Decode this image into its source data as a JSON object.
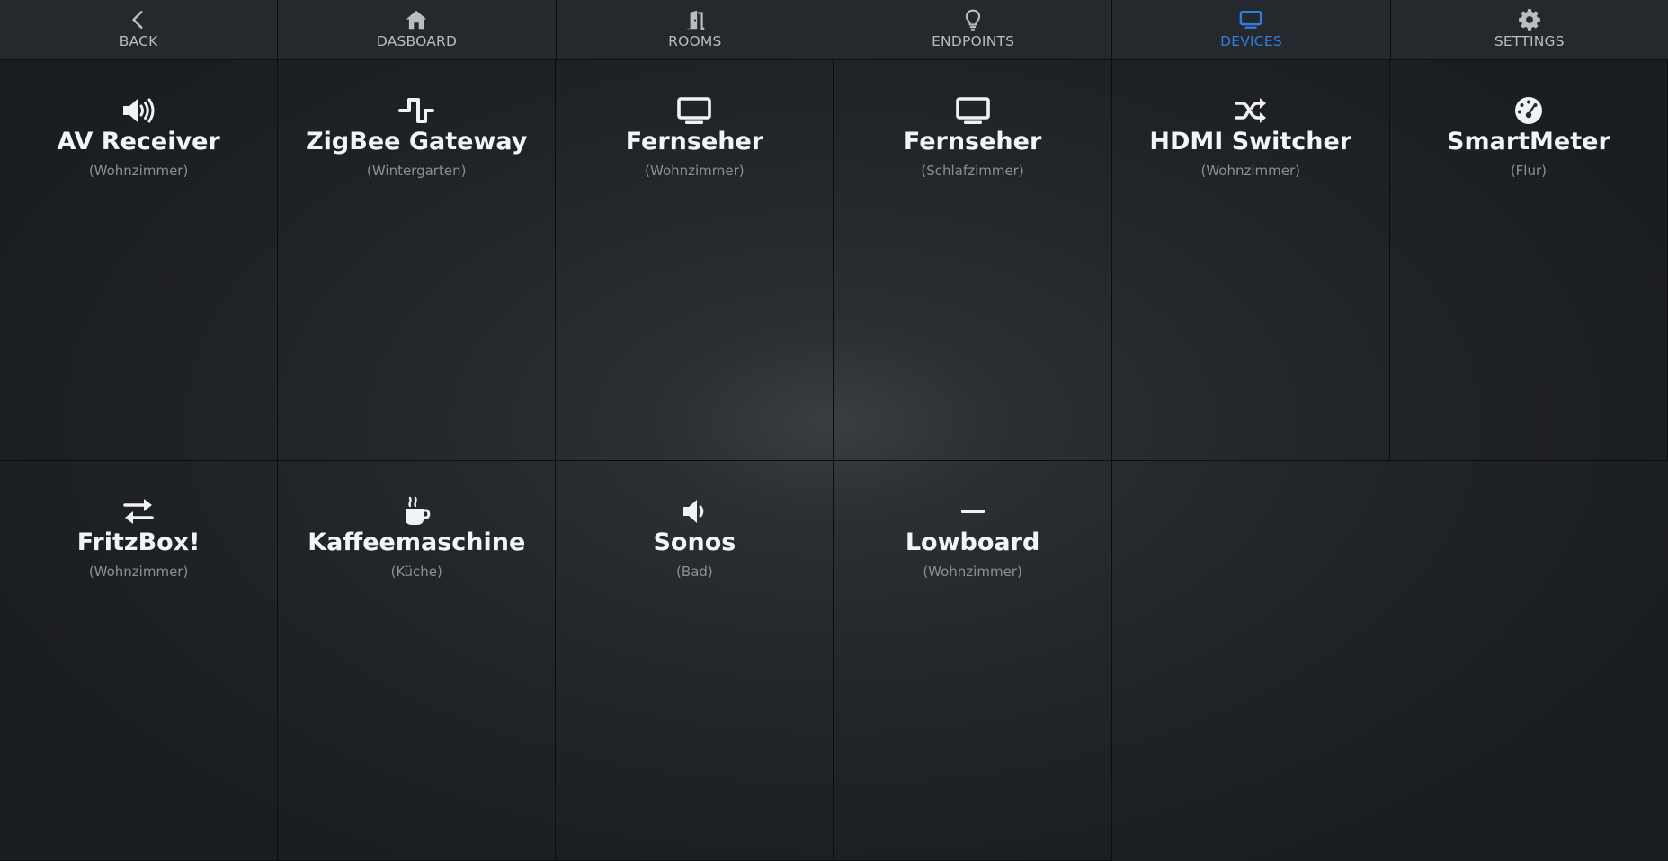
{
  "nav": {
    "items": [
      {
        "label": "BACK",
        "icon": "chevron-left-icon"
      },
      {
        "label": "DASBOARD",
        "icon": "home-icon"
      },
      {
        "label": "ROOMS",
        "icon": "door-open-icon"
      },
      {
        "label": "ENDPOINTS",
        "icon": "lightbulb-icon"
      },
      {
        "label": "DEVICES",
        "icon": "monitor-icon",
        "active": true
      },
      {
        "label": "SETTINGS",
        "icon": "gear-icon"
      }
    ],
    "active_color": "#2f7fe0"
  },
  "devices": [
    {
      "name": "AV Receiver",
      "room": "(Wohnzimmer)",
      "icon": "volume-high-icon"
    },
    {
      "name": "ZigBee Gateway",
      "room": "(Wintergarten)",
      "icon": "wave-square-icon"
    },
    {
      "name": "Fernseher",
      "room": "(Wohnzimmer)",
      "icon": "tv-icon"
    },
    {
      "name": "Fernseher",
      "room": "(Schlafzimmer)",
      "icon": "tv-icon"
    },
    {
      "name": "HDMI Switcher",
      "room": "(Wohnzimmer)",
      "icon": "shuffle-icon"
    },
    {
      "name": "SmartMeter",
      "room": "(Flur)",
      "icon": "gauge-icon"
    },
    {
      "name": "FritzBox!",
      "room": "(Wohnzimmer)",
      "icon": "exchange-arrows-icon"
    },
    {
      "name": "Kaffeemaschine",
      "room": "(Küche)",
      "icon": "coffee-mug-icon"
    },
    {
      "name": "Sonos",
      "room": "(Bad)",
      "icon": "volume-low-icon"
    },
    {
      "name": "Lowboard",
      "room": "(Wohnzimmer)",
      "icon": "minus-icon"
    }
  ]
}
